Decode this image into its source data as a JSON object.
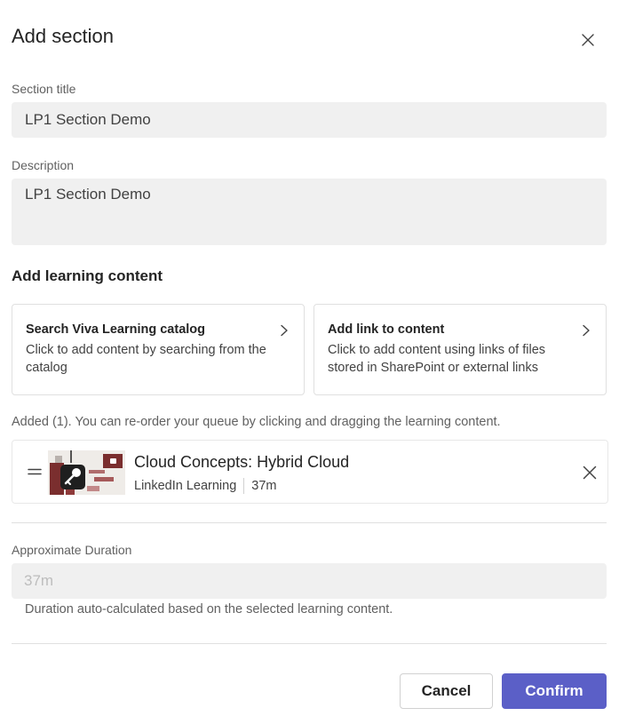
{
  "dialog": {
    "title": "Add section"
  },
  "form": {
    "section_title_label": "Section title",
    "section_title_value": "LP1 Section Demo",
    "description_label": "Description",
    "description_value": "LP1 Section Demo"
  },
  "learning_content": {
    "heading": "Add learning content",
    "options": [
      {
        "title": "Search Viva Learning catalog",
        "description": "Click to add content by searching from the catalog",
        "icon": "chevron-right-icon"
      },
      {
        "title": "Add link to content",
        "description": "Click to add content using links of files stored in SharePoint or external links",
        "icon": "chevron-right-icon"
      }
    ],
    "queue_info": "Added (1). You can re-order your queue by clicking and dragging the learning content.",
    "items": [
      {
        "title": "Cloud Concepts: Hybrid Cloud",
        "provider": "LinkedIn Learning",
        "duration": "37m"
      }
    ]
  },
  "duration": {
    "label": "Approximate Duration",
    "value": "37m",
    "hint": "Duration auto-calculated based on the selected learning content."
  },
  "actions": {
    "cancel_label": "Cancel",
    "confirm_label": "Confirm"
  },
  "colors": {
    "accent": "#5b5fc7",
    "field_background": "#f0f0f0",
    "border": "#e0e0e0"
  }
}
